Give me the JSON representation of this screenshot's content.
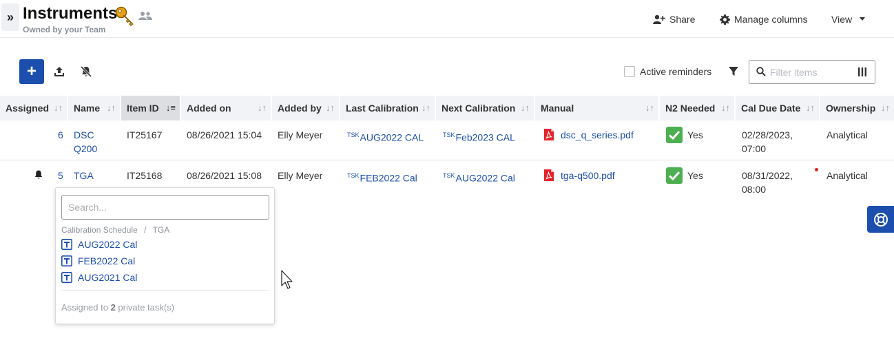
{
  "header": {
    "title": "Instruments",
    "owner_text": "Owned by your Team",
    "share_label": "Share",
    "manage_columns_label": "Manage columns",
    "view_label": "View"
  },
  "toolbar": {
    "add_label": "+",
    "active_reminders_label": "Active reminders",
    "active_reminders_checked": false,
    "filter_placeholder": "Filter items"
  },
  "table": {
    "columns": [
      "Assigned",
      "Name",
      "Item ID",
      "Added on",
      "Added by",
      "Last Calibration",
      "Next Calibration",
      "Manual",
      "N2 Needed",
      "Cal Due Date",
      "Ownership"
    ],
    "sorted_column": "Item ID",
    "rows": [
      {
        "assigned": "6",
        "name_line1": "DSC",
        "name_line2": "Q200",
        "item_id": "IT25167",
        "added_on": "08/26/2021 15:04",
        "added_by": "Elly Meyer",
        "last_cal_prefix": "TSK",
        "last_cal": "AUG2022 CAL",
        "next_cal_prefix": "TSK",
        "next_cal": "Feb2023 CAL",
        "manual": "dsc_q_series.pdf",
        "n2_needed": "Yes",
        "cal_due_line1": "02/28/2023,",
        "cal_due_line2": "07:00",
        "ownership": "Analytical"
      },
      {
        "assigned": "5",
        "name_line1": "TGA",
        "item_id": "IT25168",
        "added_on": "08/26/2021 15:08",
        "added_by": "Elly Meyer",
        "last_cal_prefix": "TSK",
        "last_cal": "FEB2022 Cal",
        "next_cal_prefix": "TSK",
        "next_cal": "AUG2022 Cal",
        "manual": "tga-q500.pdf",
        "n2_needed": "Yes",
        "cal_due_line1": "08/31/2022,",
        "cal_due_line2": "08:00",
        "ownership": "Analytical"
      }
    ]
  },
  "popup": {
    "search_placeholder": "Search...",
    "breadcrumb_root": "Calibration Schedule",
    "breadcrumb_sep": "/",
    "breadcrumb_leaf": "TGA",
    "items": [
      "AUG2022 Cal",
      "FEB2022 Cal",
      "AUG2021 Cal"
    ],
    "footer_prefix": "Assigned to",
    "footer_count": "2",
    "footer_suffix": "private task(s)"
  },
  "colors": {
    "accent": "#1c4fad",
    "check_green": "#4caf50",
    "pdf_red": "#e3242b",
    "key_gold": "#e8a317"
  },
  "icons": [
    "expand-icon",
    "key-icon",
    "team-icon",
    "share-user-icon",
    "gear-icon",
    "caret-down-icon",
    "upload-icon",
    "bell-off-icon",
    "filter-funnel-icon",
    "search-icon",
    "columns-icon",
    "bell-icon",
    "pdf-icon",
    "check-icon",
    "task-icon",
    "lifebuoy-icon"
  ]
}
